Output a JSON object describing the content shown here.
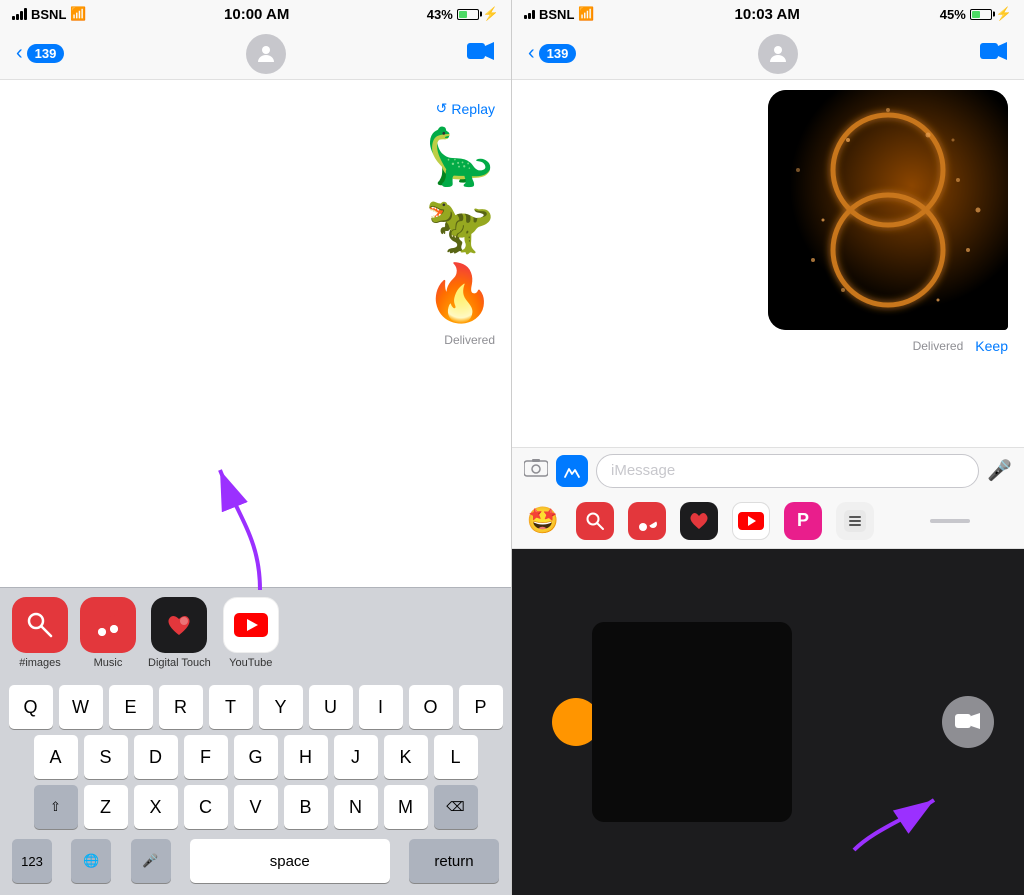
{
  "left": {
    "status": {
      "carrier": "BSNL",
      "time": "10:00 AM",
      "battery": "43%",
      "battery_pct": 43
    },
    "nav": {
      "back_count": "139",
      "video_icon": "📹"
    },
    "messages": {
      "replay_label": "Replay",
      "delivered_label": "Delivered"
    },
    "app_drawer": {
      "items": [
        {
          "label": "#images",
          "bg": "red",
          "icon": "🔍"
        },
        {
          "label": "Music",
          "bg": "red",
          "icon": "♪"
        },
        {
          "label": "Digital Touch",
          "bg": "dark",
          "icon": "♥"
        },
        {
          "label": "YouTube",
          "bg": "yt",
          "icon": "▶"
        }
      ]
    },
    "keyboard": {
      "rows": [
        [
          "Q",
          "W",
          "E",
          "R",
          "T",
          "Y",
          "U",
          "I",
          "O",
          "P"
        ],
        [
          "A",
          "S",
          "D",
          "F",
          "G",
          "H",
          "J",
          "K",
          "L"
        ],
        [
          "Z",
          "X",
          "C",
          "V",
          "B",
          "N",
          "M"
        ]
      ],
      "space_label": "space",
      "return_label": "return",
      "numbers_label": "123"
    }
  },
  "right": {
    "status": {
      "carrier": "BSNL",
      "time": "10:03 AM",
      "battery": "45%",
      "battery_pct": 45
    },
    "nav": {
      "back_count": "139"
    },
    "messages": {
      "delivered_label": "Delivered",
      "keep_label": "Keep"
    },
    "input": {
      "placeholder": "iMessage"
    },
    "strip_icons": [
      "emoji_face",
      "search",
      "music",
      "dt_heart",
      "youtube",
      "producthunt",
      "more"
    ]
  }
}
